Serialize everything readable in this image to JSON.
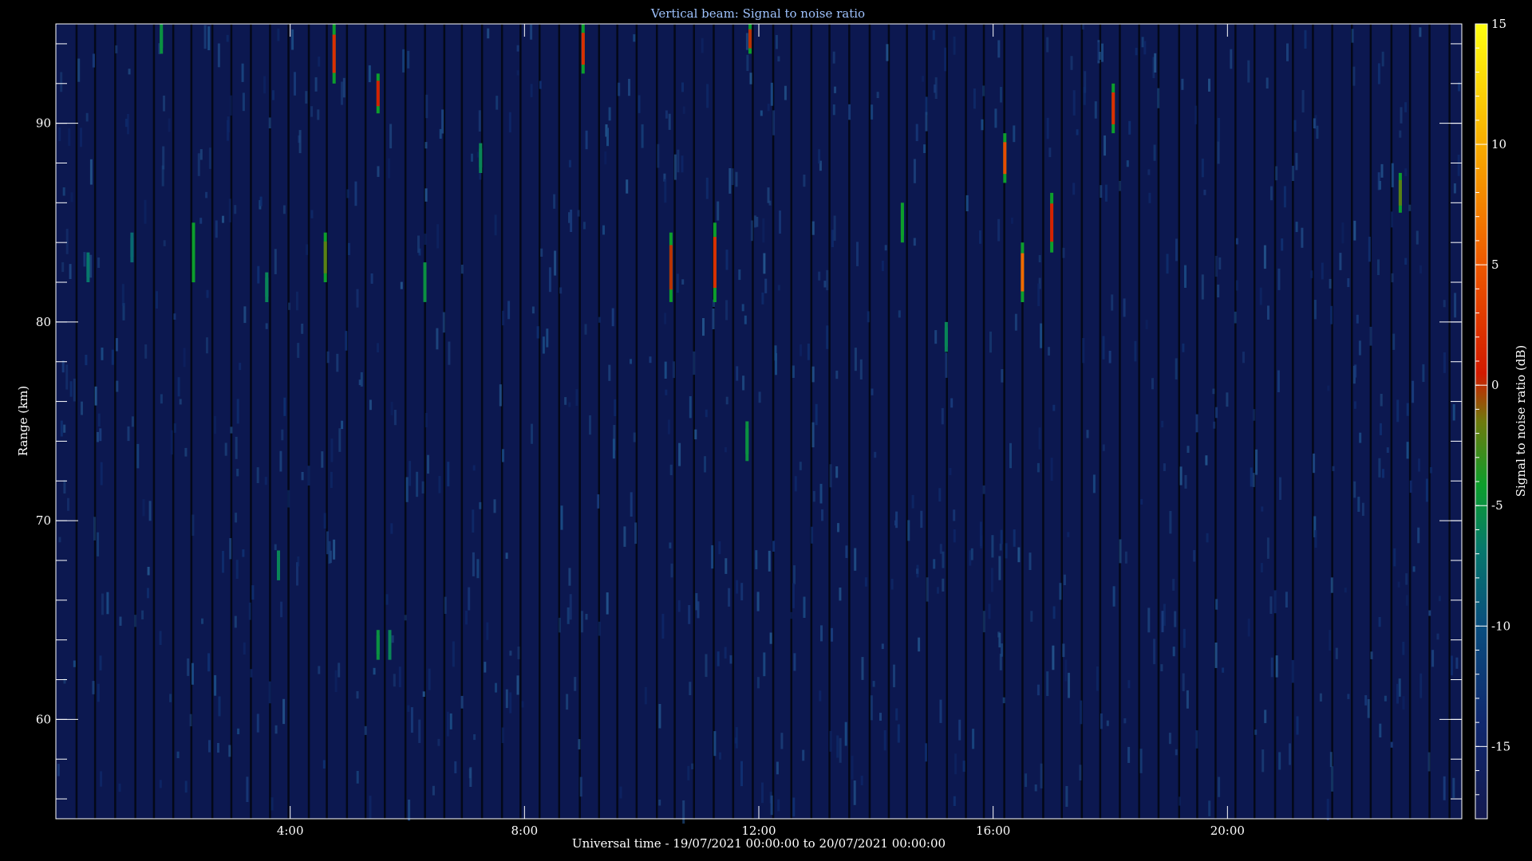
{
  "chart_data": {
    "type": "heatmap",
    "title": "Vertical beam: Signal to noise ratio",
    "xlabel": "Universal time - 19/07/2021 00:00:00 to 20/07/2021 00:00:00",
    "ylabel": "Range (km)",
    "colorbar_label": "Signal to noise ratio (dB)",
    "x_unit": "hours UT",
    "xlim": [
      0,
      24
    ],
    "ylim": [
      55,
      95
    ],
    "x_ticks": [
      {
        "value": 4,
        "label": "4:00"
      },
      {
        "value": 8,
        "label": "8:00"
      },
      {
        "value": 12,
        "label": "12:00"
      },
      {
        "value": 16,
        "label": "16:00"
      },
      {
        "value": 20,
        "label": "20:00"
      }
    ],
    "y_ticks": [
      {
        "value": 60,
        "label": "60"
      },
      {
        "value": 70,
        "label": "70"
      },
      {
        "value": 80,
        "label": "80"
      },
      {
        "value": 90,
        "label": "90"
      }
    ],
    "colorbar_ticks": [
      {
        "value": 15,
        "label": "15"
      },
      {
        "value": 10,
        "label": "10"
      },
      {
        "value": 5,
        "label": "5"
      },
      {
        "value": 0,
        "label": "0"
      },
      {
        "value": -5,
        "label": "-5"
      },
      {
        "value": -10,
        "label": "-10"
      },
      {
        "value": -15,
        "label": "-15"
      }
    ],
    "color_range": [
      -18,
      15
    ],
    "background_snr_db": -16,
    "events": [
      {
        "time": 0.55,
        "range_min": 82.0,
        "range_max": 83.5,
        "snr_db": -7
      },
      {
        "time": 1.3,
        "range_min": 83.0,
        "range_max": 84.5,
        "snr_db": -8
      },
      {
        "time": 1.8,
        "range_min": 93.5,
        "range_max": 95.0,
        "snr_db": -5
      },
      {
        "time": 2.35,
        "range_min": 82.0,
        "range_max": 85.0,
        "snr_db": -4
      },
      {
        "time": 3.6,
        "range_min": 81.0,
        "range_max": 82.5,
        "snr_db": -6
      },
      {
        "time": 3.8,
        "range_min": 67.0,
        "range_max": 68.5,
        "snr_db": -6
      },
      {
        "time": 4.6,
        "range_min": 82.0,
        "range_max": 84.5,
        "snr_db": -2
      },
      {
        "time": 4.75,
        "range_min": 92.0,
        "range_max": 95.0,
        "snr_db": 2
      },
      {
        "time": 5.5,
        "range_min": 90.5,
        "range_max": 92.5,
        "snr_db": 1
      },
      {
        "time": 5.5,
        "range_min": 63.0,
        "range_max": 64.5,
        "snr_db": -5
      },
      {
        "time": 5.7,
        "range_min": 63.0,
        "range_max": 64.5,
        "snr_db": -6
      },
      {
        "time": 6.3,
        "range_min": 81.0,
        "range_max": 83.0,
        "snr_db": -5
      },
      {
        "time": 7.25,
        "range_min": 87.5,
        "range_max": 89.0,
        "snr_db": -6
      },
      {
        "time": 9.0,
        "range_min": 92.5,
        "range_max": 95.0,
        "snr_db": 2
      },
      {
        "time": 10.5,
        "range_min": 81.0,
        "range_max": 84.5,
        "snr_db": 0
      },
      {
        "time": 11.25,
        "range_min": 81.0,
        "range_max": 85.0,
        "snr_db": 2
      },
      {
        "time": 11.8,
        "range_min": 73.0,
        "range_max": 75.0,
        "snr_db": -5
      },
      {
        "time": 11.85,
        "range_min": 93.5,
        "range_max": 95.0,
        "snr_db": 0
      },
      {
        "time": 14.45,
        "range_min": 84.0,
        "range_max": 86.0,
        "snr_db": -4
      },
      {
        "time": 15.2,
        "range_min": 78.5,
        "range_max": 80.0,
        "snr_db": -6
      },
      {
        "time": 16.2,
        "range_min": 87.0,
        "range_max": 89.5,
        "snr_db": 4
      },
      {
        "time": 16.5,
        "range_min": 81.0,
        "range_max": 84.0,
        "snr_db": 6
      },
      {
        "time": 17.0,
        "range_min": 83.5,
        "range_max": 86.5,
        "snr_db": 1
      },
      {
        "time": 18.05,
        "range_min": 89.5,
        "range_max": 92.0,
        "snr_db": 2
      },
      {
        "time": 22.95,
        "range_min": 85.5,
        "range_max": 87.5,
        "snr_db": -2
      }
    ]
  }
}
